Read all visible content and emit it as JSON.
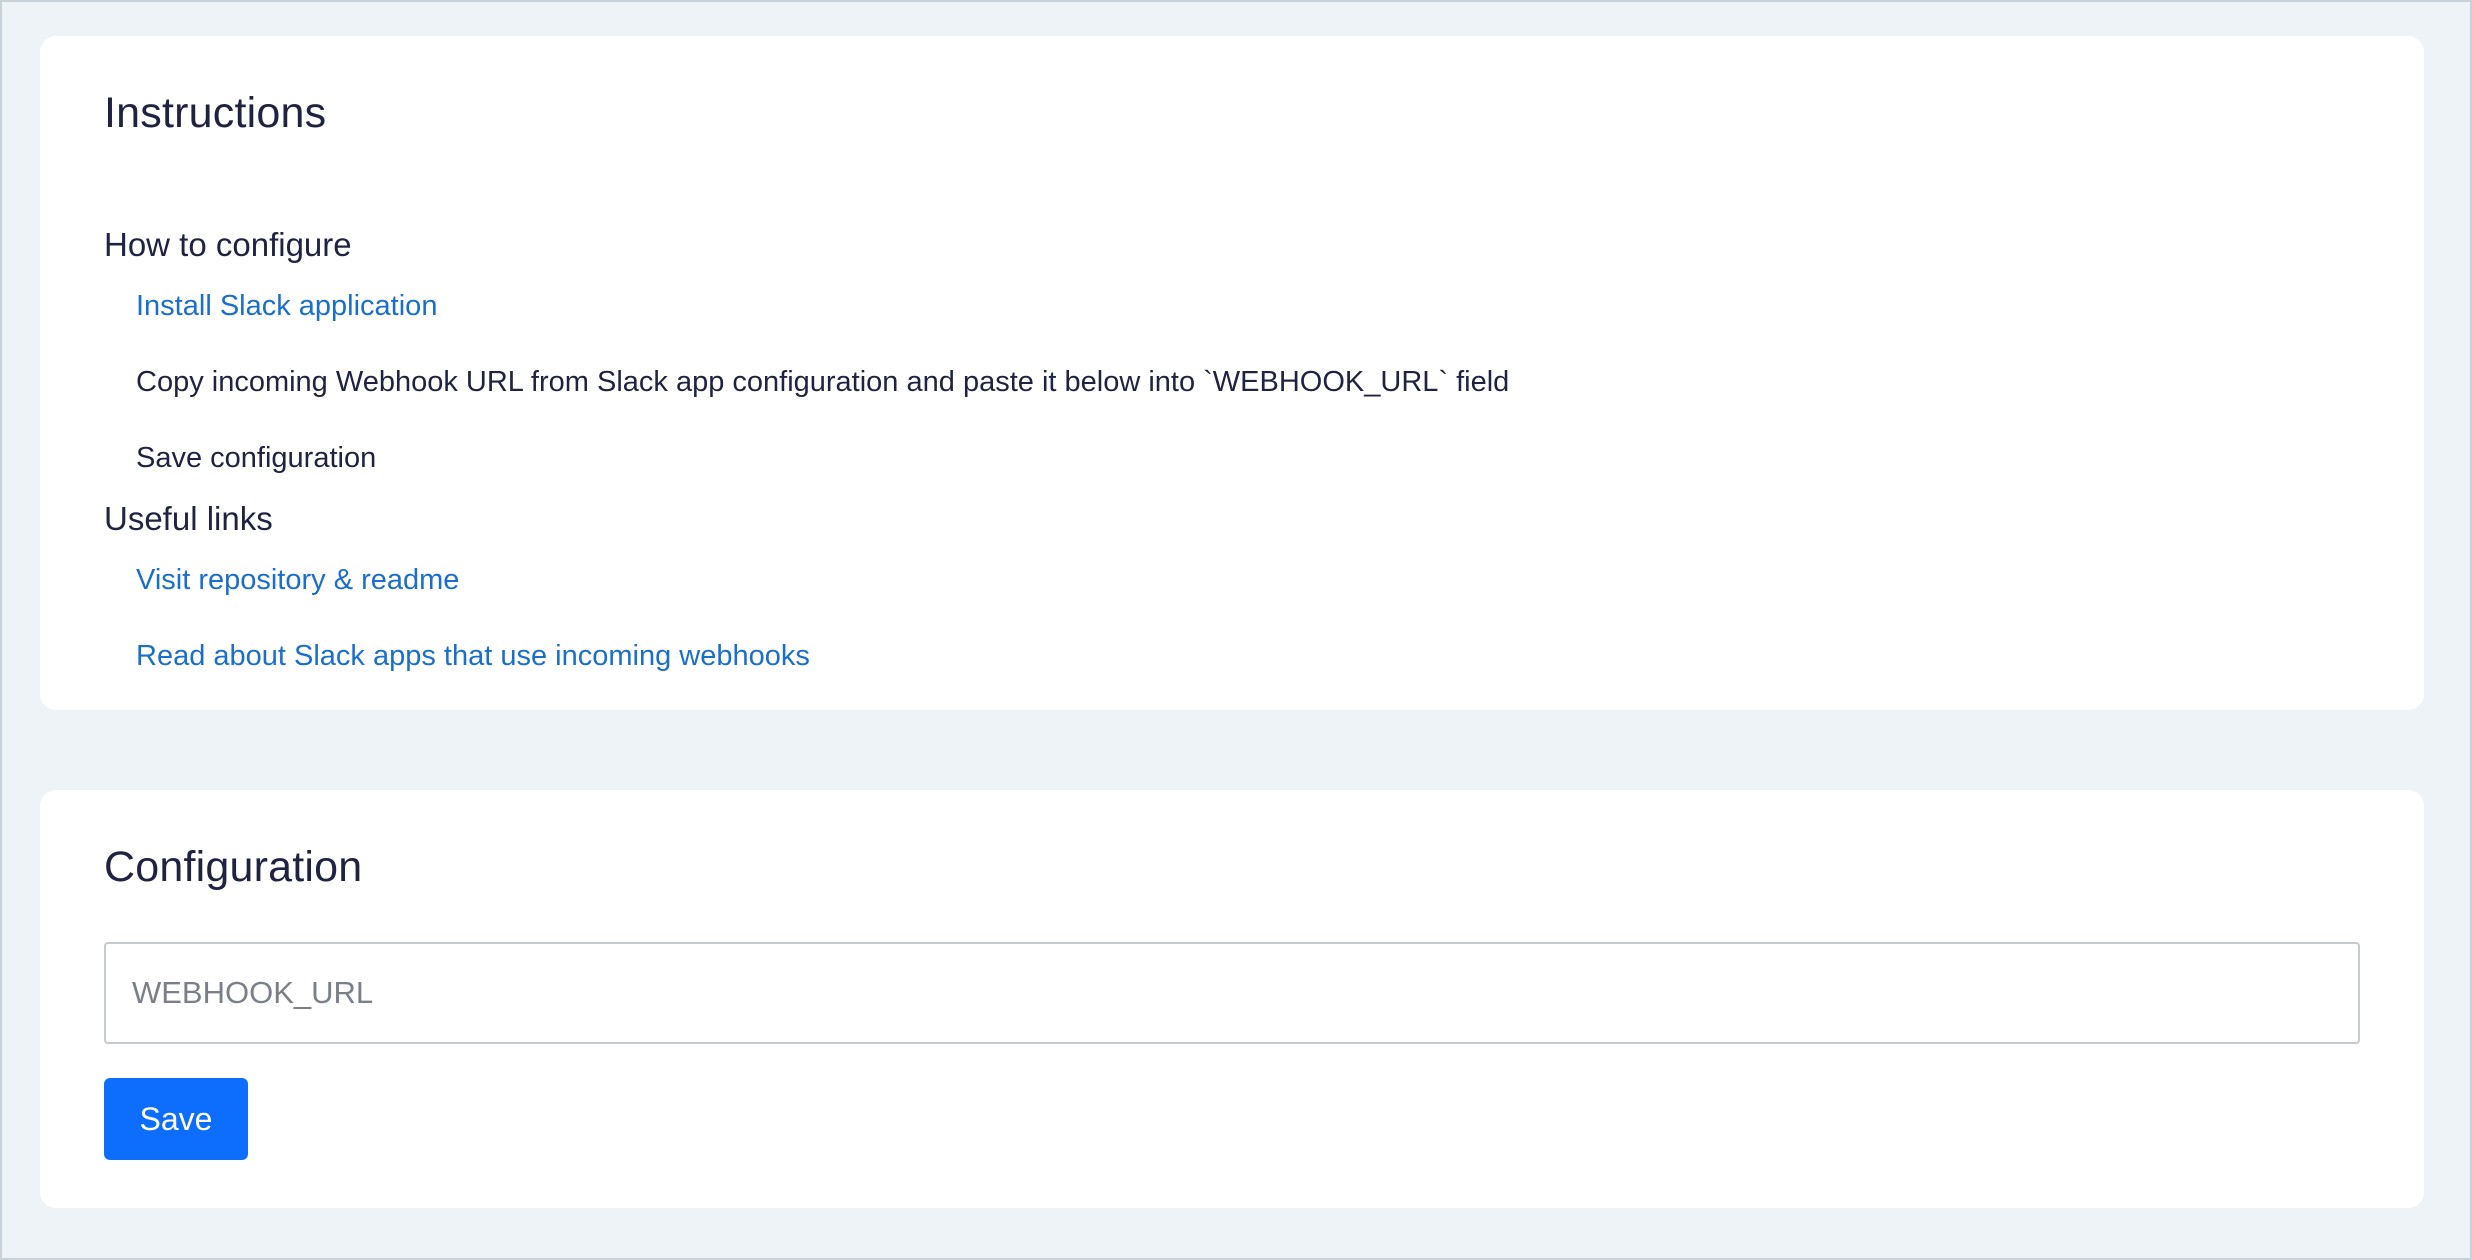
{
  "instructions": {
    "title": "Instructions",
    "how_to_configure": {
      "heading": "How to configure",
      "steps": [
        {
          "label": "Install Slack application",
          "is_link": true
        },
        {
          "label": "Copy incoming Webhook URL from Slack app configuration and paste it below into `WEBHOOK_URL` field",
          "is_link": false
        },
        {
          "label": "Save configuration",
          "is_link": false
        }
      ]
    },
    "useful_links": {
      "heading": "Useful links",
      "links": [
        {
          "label": "Visit repository & readme"
        },
        {
          "label": "Read about Slack apps that use incoming webhooks"
        }
      ]
    }
  },
  "configuration": {
    "title": "Configuration",
    "webhook_field": {
      "placeholder": "WEBHOOK_URL",
      "value": ""
    },
    "save_label": "Save"
  },
  "colors": {
    "page_background": "#eef3f7",
    "card_background": "#ffffff",
    "link": "#1a6fce",
    "primary_button": "#0d6efd",
    "text": "#1f2341"
  }
}
